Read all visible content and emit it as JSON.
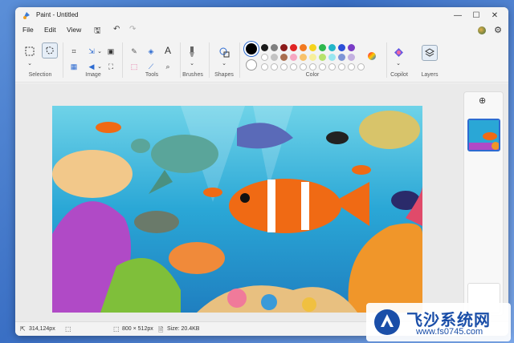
{
  "window": {
    "title": "Paint - Untitled"
  },
  "menu": {
    "file": "File",
    "edit": "Edit",
    "view": "View"
  },
  "ribbon": {
    "groups": {
      "selection": "Selection",
      "image": "Image",
      "tools": "Tools",
      "brushes": "Brushes",
      "shapes": "Shapes",
      "color": "Color",
      "copilot": "Copilot",
      "layers": "Layers"
    },
    "tools_text_glyph": "A",
    "palette_row1": [
      "#1a1a1a",
      "#7f7f7f",
      "#8b1a1a",
      "#e02424",
      "#f2791f",
      "#f5d31c",
      "#2eb84d",
      "#21b6c9",
      "#2b4fd8",
      "#7a3cc6"
    ],
    "palette_row2": [
      "#ffffff",
      "#c3c3c3",
      "#a96e4f",
      "#f6a6c1",
      "#f8c26a",
      "#f7ef9b",
      "#b6e26c",
      "#98e6f0",
      "#7d95d6",
      "#c3b0e0"
    ],
    "primary_color": "#000000",
    "secondary_color": "#ffffff"
  },
  "status": {
    "cursor_pos": "314,124px",
    "canvas_size": "800 × 512px",
    "file_size": "Size: 20.4KB"
  },
  "watermark": {
    "title": "飞沙系统网",
    "url": "www.fs0745.com"
  }
}
